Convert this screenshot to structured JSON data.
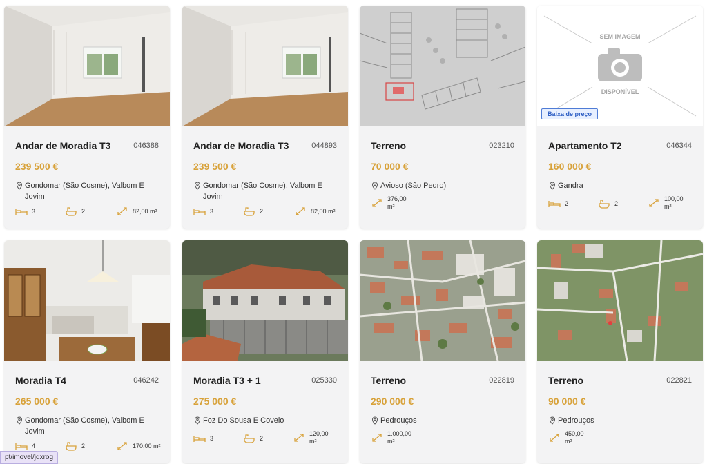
{
  "listings": [
    {
      "title": "Andar de Moradia T3",
      "ref": "046388",
      "price": "239 500 €",
      "location": "Gondomar (São Cosme), Valbom E Jovim",
      "beds": "3",
      "baths": "2",
      "area": "82,00 m²"
    },
    {
      "title": "Andar de Moradia T3",
      "ref": "044893",
      "price": "239 500 €",
      "location": "Gondomar (São Cosme), Valbom E Jovim",
      "beds": "3",
      "baths": "2",
      "area": "82,00 m²"
    },
    {
      "title": "Terreno",
      "ref": "023210",
      "price": "70 000 €",
      "location": "Avioso (São Pedro)",
      "area_line1": "376,00",
      "area_line2": "m²"
    },
    {
      "title": "Apartamento T2",
      "ref": "046344",
      "price": "160 000 €",
      "location": "Gandra",
      "beds": "2",
      "baths": "2",
      "area_line1": "100,00",
      "area_line2": "m²",
      "badge": "Baixa de preço",
      "no_image_top": "SEM IMAGEM",
      "no_image_bottom": "DISPONÍVEL"
    },
    {
      "title": "Moradia T4",
      "ref": "046242",
      "price": "265 000 €",
      "location": "Gondomar (São Cosme), Valbom E Jovim",
      "beds": "4",
      "baths": "2",
      "area": "170,00 m²"
    },
    {
      "title": "Moradia T3 + 1",
      "ref": "025330",
      "price": "275 000 €",
      "location": "Foz Do Sousa E Covelo",
      "beds": "3",
      "baths": "2",
      "area_line1": "120,00",
      "area_line2": "m²"
    },
    {
      "title": "Terreno",
      "ref": "022819",
      "price": "290 000 €",
      "location": "Pedrouços",
      "area_line1": "1.000,00",
      "area_line2": "m²"
    },
    {
      "title": "Terreno",
      "ref": "022821",
      "price": "90 000 €",
      "location": "Pedrouços",
      "area_line1": "450,00",
      "area_line2": "m²"
    }
  ],
  "status_bar": {
    "url": "pt/imovel/jqxrog"
  },
  "colors": {
    "price": "#d8a23a",
    "icon": "#d8a23a",
    "badge_border": "#4f7cd6"
  }
}
